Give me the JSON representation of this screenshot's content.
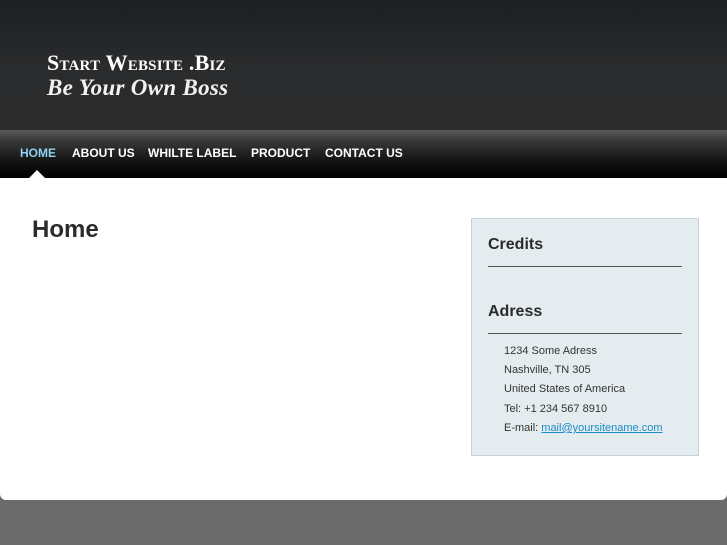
{
  "header": {
    "brand_line1": "Start Website .Biz",
    "brand_line2": "Be Your Own Boss"
  },
  "nav": {
    "items": [
      {
        "label": "HOME",
        "active": true
      },
      {
        "label": "ABOUT US",
        "active": false
      },
      {
        "label": "WHILTE LABEL",
        "active": false
      },
      {
        "label": "PRODUCT",
        "active": false
      },
      {
        "label": "CONTACT US",
        "active": false
      }
    ]
  },
  "main": {
    "title": "Home"
  },
  "sidebar": {
    "credits_heading": "Credits",
    "address_heading": "Adress",
    "address": {
      "line1": "1234 Some Adress",
      "line2": "Nashville, TN 305",
      "line3": "United States of America",
      "phone": "Tel: +1 234 567 8910",
      "email_label": "E-mail: ",
      "email": "mail@yoursitename.com"
    }
  },
  "colors": {
    "nav_active": "#8ed1f4",
    "link": "#1a8cc8",
    "sidebar_bg": "#e4ecf0"
  }
}
